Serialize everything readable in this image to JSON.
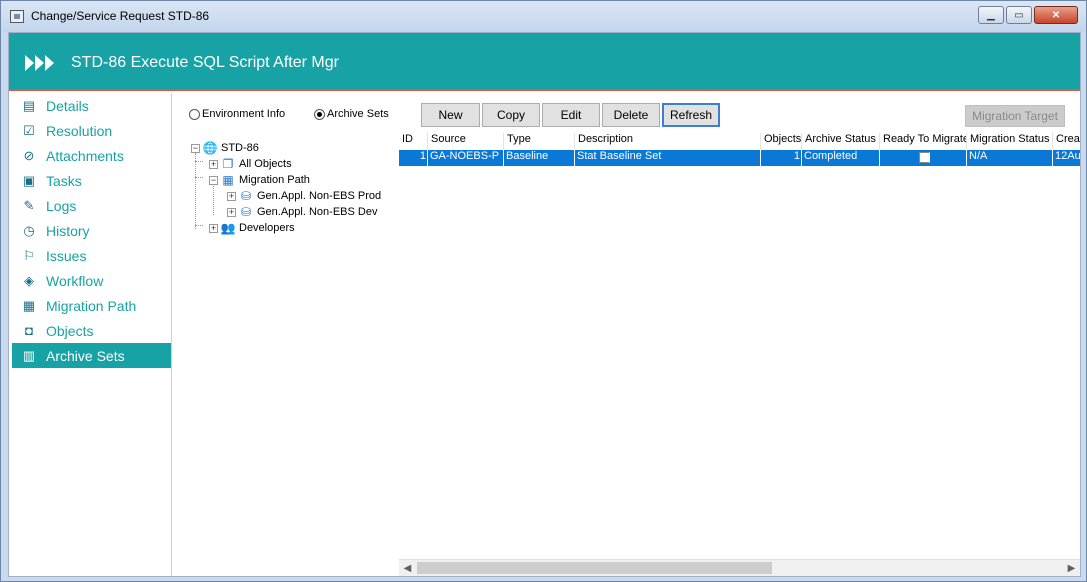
{
  "window": {
    "title": "Change/Service Request STD-86"
  },
  "header": {
    "title": "STD-86  Execute SQL Script After Mgr"
  },
  "nav": {
    "items": [
      {
        "label": "Details",
        "icon": "details-icon"
      },
      {
        "label": "Resolution",
        "icon": "resolution-icon"
      },
      {
        "label": "Attachments",
        "icon": "paperclip-icon"
      },
      {
        "label": "Tasks",
        "icon": "clipboard-icon"
      },
      {
        "label": "Logs",
        "icon": "log-icon"
      },
      {
        "label": "History",
        "icon": "clock-icon"
      },
      {
        "label": "Issues",
        "icon": "flag-icon"
      },
      {
        "label": "Workflow",
        "icon": "workflow-icon"
      },
      {
        "label": "Migration Path",
        "icon": "migration-icon"
      },
      {
        "label": "Objects",
        "icon": "objects-icon"
      },
      {
        "label": "Archive Sets",
        "icon": "archive-icon"
      }
    ],
    "active_index": 10
  },
  "view_options": {
    "environment_info": "Environment Info",
    "archive_sets": "Archive Sets",
    "selected": "Archive Sets"
  },
  "toolbar": {
    "new": "New",
    "copy": "Copy",
    "edit": "Edit",
    "delete": "Delete",
    "refresh": "Refresh",
    "migration_target": "Migration Target"
  },
  "tree": {
    "root": "STD-86",
    "all_objects": "All Objects",
    "migration_path": "Migration Path",
    "prod": "Gen.Appl. Non-EBS Prod",
    "dev": "Gen.Appl. Non-EBS Dev",
    "developers": "Developers"
  },
  "grid": {
    "columns": [
      "ID",
      "Source",
      "Type",
      "Description",
      "Objects",
      "Archive Status",
      "Ready To Migrate",
      "Migration Status",
      "Crea"
    ],
    "rows": [
      {
        "id": "1",
        "source": "GA-NOEBS-P",
        "type": "Baseline",
        "description": "Stat Baseline Set",
        "objects": "1",
        "archive_status": "Completed",
        "ready_to_migrate": false,
        "migration_status": "N/A",
        "created": "12Au"
      }
    ]
  },
  "colors": {
    "accent": "#17a3a5",
    "selection": "#0a78d7",
    "header_underline": "#d85a4a"
  }
}
